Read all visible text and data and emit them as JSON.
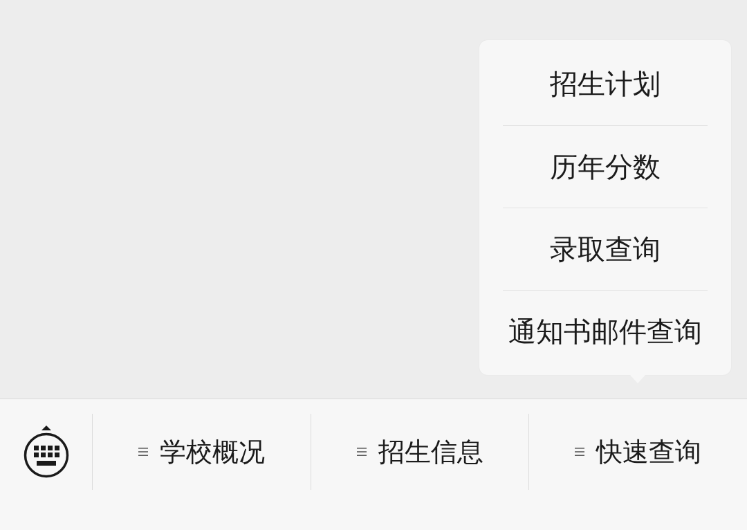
{
  "menu_bar": {
    "items": [
      {
        "label": "学校概况"
      },
      {
        "label": "招生信息"
      },
      {
        "label": "快速查询",
        "submenu": [
          {
            "label": "招生计划"
          },
          {
            "label": "历年分数"
          },
          {
            "label": "录取查询"
          },
          {
            "label": "通知书邮件查询"
          }
        ]
      }
    ]
  }
}
